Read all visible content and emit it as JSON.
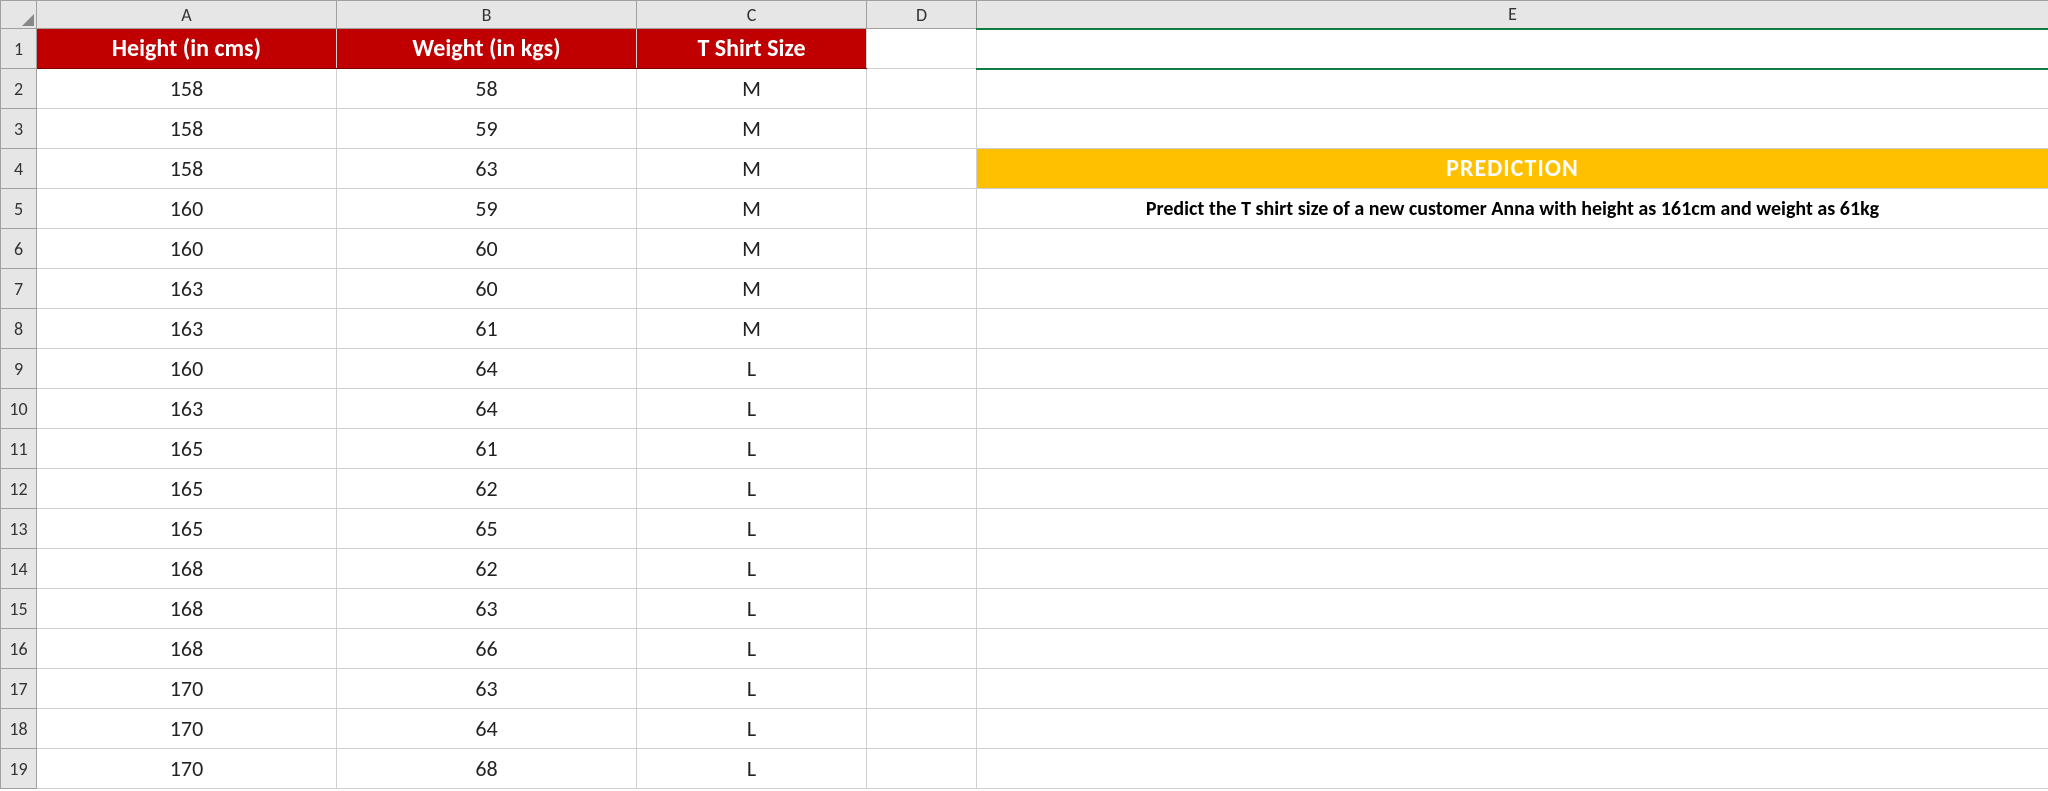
{
  "columns": {
    "A": "A",
    "B": "B",
    "C": "C",
    "D": "D",
    "E": "E"
  },
  "row_headers": [
    "1",
    "2",
    "3",
    "4",
    "5",
    "6",
    "7",
    "8",
    "9",
    "10",
    "11",
    "12",
    "13",
    "14",
    "15",
    "16",
    "17",
    "18",
    "19"
  ],
  "table_headers": {
    "A": "Height (in cms)",
    "B": "Weight (in kgs)",
    "C": "T Shirt Size"
  },
  "data_rows": [
    {
      "height": "158",
      "weight": "58",
      "size": "M"
    },
    {
      "height": "158",
      "weight": "59",
      "size": "M"
    },
    {
      "height": "158",
      "weight": "63",
      "size": "M"
    },
    {
      "height": "160",
      "weight": "59",
      "size": "M"
    },
    {
      "height": "160",
      "weight": "60",
      "size": "M"
    },
    {
      "height": "163",
      "weight": "60",
      "size": "M"
    },
    {
      "height": "163",
      "weight": "61",
      "size": "M"
    },
    {
      "height": "160",
      "weight": "64",
      "size": "L"
    },
    {
      "height": "163",
      "weight": "64",
      "size": "L"
    },
    {
      "height": "165",
      "weight": "61",
      "size": "L"
    },
    {
      "height": "165",
      "weight": "62",
      "size": "L"
    },
    {
      "height": "165",
      "weight": "65",
      "size": "L"
    },
    {
      "height": "168",
      "weight": "62",
      "size": "L"
    },
    {
      "height": "168",
      "weight": "63",
      "size": "L"
    },
    {
      "height": "168",
      "weight": "66",
      "size": "L"
    },
    {
      "height": "170",
      "weight": "63",
      "size": "L"
    },
    {
      "height": "170",
      "weight": "64",
      "size": "L"
    },
    {
      "height": "170",
      "weight": "68",
      "size": "L"
    }
  ],
  "prediction": {
    "banner": "PREDICTION",
    "text": "Predict the T shirt size of a new customer Anna with height as 161cm and weight as 61kg"
  },
  "chart_data": {
    "type": "table",
    "title": "T Shirt Size by Height and Weight",
    "columns": [
      "Height (in cms)",
      "Weight (in kgs)",
      "T Shirt Size"
    ],
    "rows": [
      [
        158,
        58,
        "M"
      ],
      [
        158,
        59,
        "M"
      ],
      [
        158,
        63,
        "M"
      ],
      [
        160,
        59,
        "M"
      ],
      [
        160,
        60,
        "M"
      ],
      [
        163,
        60,
        "M"
      ],
      [
        163,
        61,
        "M"
      ],
      [
        160,
        64,
        "L"
      ],
      [
        163,
        64,
        "L"
      ],
      [
        165,
        61,
        "L"
      ],
      [
        165,
        62,
        "L"
      ],
      [
        165,
        65,
        "L"
      ],
      [
        168,
        62,
        "L"
      ],
      [
        168,
        63,
        "L"
      ],
      [
        168,
        66,
        "L"
      ],
      [
        170,
        63,
        "L"
      ],
      [
        170,
        64,
        "L"
      ],
      [
        170,
        68,
        "L"
      ]
    ]
  }
}
